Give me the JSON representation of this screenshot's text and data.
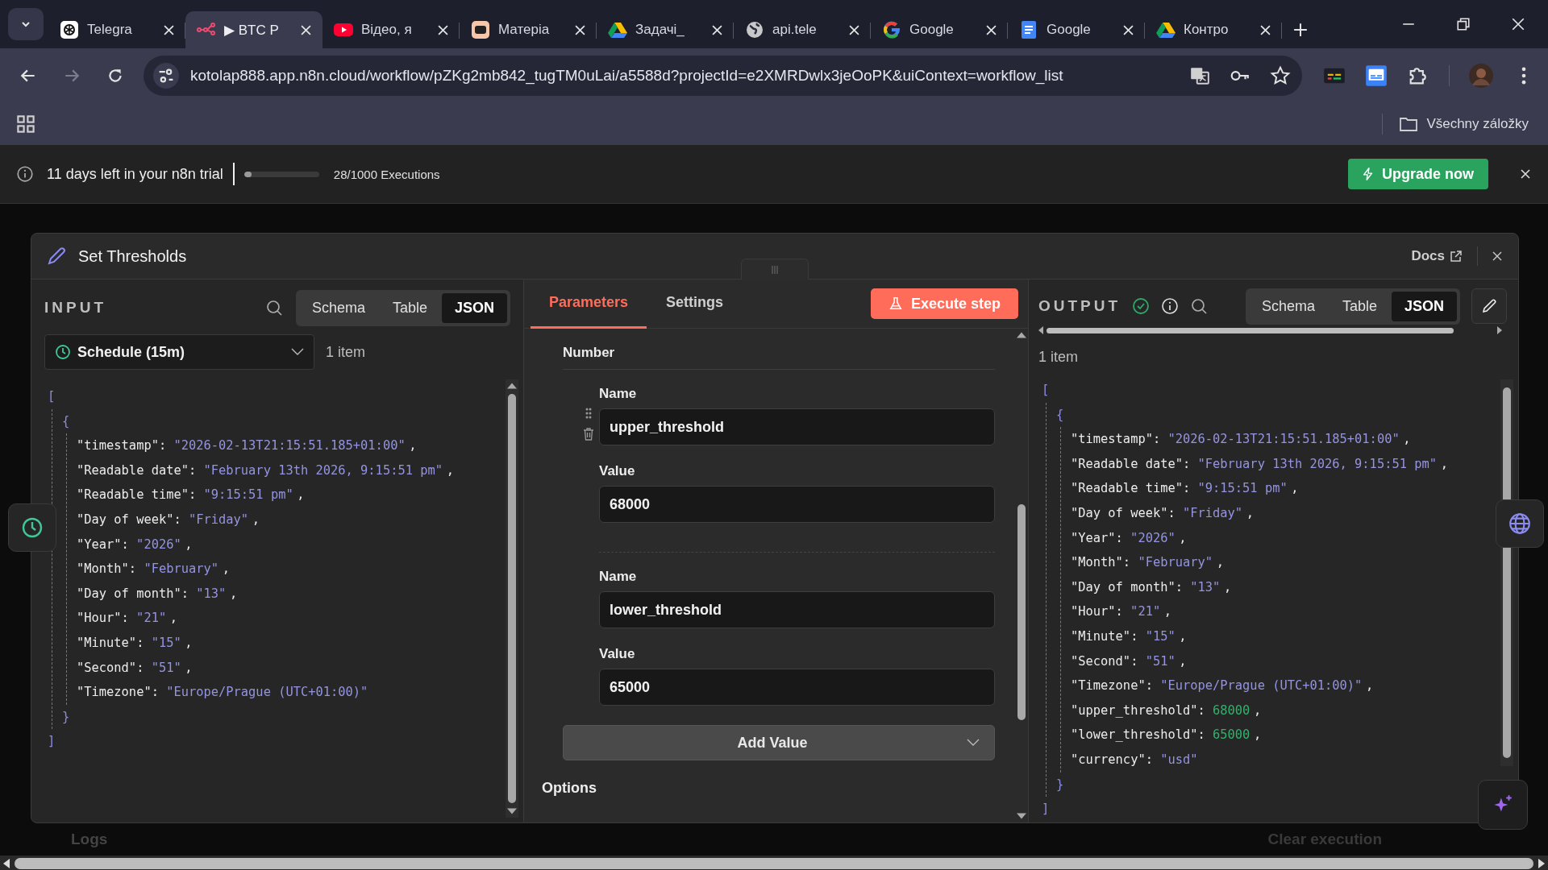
{
  "browser": {
    "tabs": [
      {
        "title": "Telegra",
        "kind": "knot",
        "selected": false
      },
      {
        "title": "▶ BTC P",
        "kind": "nodes",
        "selected": true
      },
      {
        "title": "Відео, я",
        "kind": "play",
        "selected": false
      },
      {
        "title": "Матеріа",
        "kind": "app",
        "selected": false
      },
      {
        "title": "Задачі_",
        "kind": "triangle",
        "selected": false
      },
      {
        "title": "api.tele",
        "kind": "globe",
        "selected": false
      },
      {
        "title": "Google",
        "kind": "g",
        "selected": false
      },
      {
        "title": "Google",
        "kind": "doc",
        "selected": false
      },
      {
        "title": "Контро",
        "kind": "triangle",
        "selected": false
      }
    ],
    "url": "kotolap888.app.n8n.cloud/workflow/pZKg2mb842_tugTM0uLai/a5588d?projectId=e2XMRDwlx3jeOoPK&uiContext=workflow_list",
    "bookmarks_folder": "Všechny záložky"
  },
  "trial": {
    "message": "11 days left in your n8n trial",
    "level": 0.028,
    "executions": "28/1000 Executions",
    "upgrade": "Upgrade now"
  },
  "node": {
    "title": "Set Thresholds",
    "docs": "Docs"
  },
  "input": {
    "label": "INPUT",
    "views": [
      {
        "label": "Schema",
        "selected": false
      },
      {
        "label": "Table",
        "selected": false
      },
      {
        "label": "JSON",
        "selected": true
      }
    ],
    "source": "Schedule (15m)",
    "count": "1 item",
    "json": {
      "open": [
        "[",
        "{"
      ],
      "close": [
        "}",
        "]"
      ],
      "lines": [
        {
          "key": "\"timestamp\":",
          "value": "\"2026-02-13T21:15:51.185+01:00\"",
          "kind": "string",
          "sep": ","
        },
        {
          "key": "\"Readable date\":",
          "value": "\"February 13th 2026, 9:15:51 pm\"",
          "kind": "string",
          "sep": ","
        },
        {
          "key": "\"Readable time\":",
          "value": "\"9:15:51 pm\"",
          "kind": "string",
          "sep": ","
        },
        {
          "key": "\"Day of week\":",
          "value": "\"Friday\"",
          "kind": "string",
          "sep": ","
        },
        {
          "key": "\"Year\":",
          "value": "\"2026\"",
          "kind": "string",
          "sep": ","
        },
        {
          "key": "\"Month\":",
          "value": "\"February\"",
          "kind": "string",
          "sep": ","
        },
        {
          "key": "\"Day of month\":",
          "value": "\"13\"",
          "kind": "string",
          "sep": ","
        },
        {
          "key": "\"Hour\":",
          "value": "\"21\"",
          "kind": "string",
          "sep": ","
        },
        {
          "key": "\"Minute\":",
          "value": "\"15\"",
          "kind": "string",
          "sep": ","
        },
        {
          "key": "\"Second\":",
          "value": "\"51\"",
          "kind": "string",
          "sep": ","
        },
        {
          "key": "\"Timezone\":",
          "value": "\"Europe/Prague (UTC+01:00)\"",
          "kind": "string"
        }
      ]
    }
  },
  "parameters": {
    "tabs": [
      {
        "label": "Parameters",
        "selected": true
      },
      {
        "label": "Settings",
        "selected": false
      }
    ],
    "execute": "Execute step",
    "section": "Number",
    "fields": [
      {
        "hovered": true,
        "name_label": "Name",
        "name": "upper_threshold",
        "value_label": "Value",
        "value": "68000"
      },
      {
        "hovered": false,
        "name_label": "Name",
        "name": "lower_threshold",
        "value_label": "Value",
        "value": "65000"
      }
    ],
    "add": "Add Value",
    "options": "Options"
  },
  "output": {
    "label": "OUTPUT",
    "views": [
      {
        "label": "Schema",
        "selected": false
      },
      {
        "label": "Table",
        "selected": false
      },
      {
        "label": "JSON",
        "selected": true
      }
    ],
    "count": "1 item",
    "json": {
      "open": [
        "[",
        "{"
      ],
      "close": [
        "}",
        "]"
      ],
      "lines": [
        {
          "key": "\"timestamp\":",
          "value": "\"2026-02-13T21:15:51.185+01:00\"",
          "kind": "string",
          "sep": ","
        },
        {
          "key": "\"Readable date\":",
          "value": "\"February 13th 2026, 9:15:51 pm\"",
          "kind": "string",
          "sep": ","
        },
        {
          "key": "\"Readable time\":",
          "value": "\"9:15:51 pm\"",
          "kind": "string",
          "sep": ","
        },
        {
          "key": "\"Day of week\":",
          "value": "\"Friday\"",
          "kind": "string",
          "sep": ","
        },
        {
          "key": "\"Year\":",
          "value": "\"2026\"",
          "kind": "string",
          "sep": ","
        },
        {
          "key": "\"Month\":",
          "value": "\"February\"",
          "kind": "string",
          "sep": ","
        },
        {
          "key": "\"Day of month\":",
          "value": "\"13\"",
          "kind": "string",
          "sep": ","
        },
        {
          "key": "\"Hour\":",
          "value": "\"21\"",
          "kind": "string",
          "sep": ","
        },
        {
          "key": "\"Minute\":",
          "value": "\"15\"",
          "kind": "string",
          "sep": ","
        },
        {
          "key": "\"Second\":",
          "value": "\"51\"",
          "kind": "string",
          "sep": ","
        },
        {
          "key": "\"Timezone\":",
          "value": "\"Europe/Prague (UTC+01:00)\"",
          "kind": "string",
          "sep": ","
        },
        {
          "key": "\"upper_threshold\":",
          "value": "68000",
          "kind": "number",
          "sep": ","
        },
        {
          "key": "\"lower_threshold\":",
          "value": "65000",
          "kind": "number",
          "sep": ","
        },
        {
          "key": "\"currency\":",
          "value": "\"usd\"",
          "kind": "string"
        }
      ]
    }
  },
  "footer": {
    "logs": "Logs",
    "clear": "Clear execution"
  }
}
